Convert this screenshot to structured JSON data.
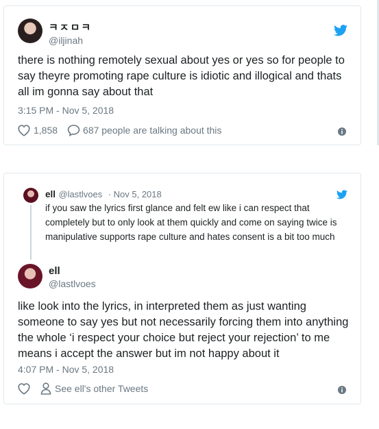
{
  "tweet1": {
    "name": "ㅋㅈㅁㅋ",
    "handle": "@iljinah",
    "text": "there is nothing remotely sexual about yes or yes so for people to say theyre promoting rape culture is idiotic and illogical and thats all im gonna say about that",
    "timestamp": "3:15 PM - Nov 5, 2018",
    "like_count": "1,858",
    "conversation": "687 people are talking about this"
  },
  "tweet2": {
    "quoted": {
      "name": "ell",
      "handle": "@lastlvoes",
      "date": "· Nov 5, 2018",
      "text": "if you saw the lyrics first glance and felt ew like i can respect that completely but to only look at them quickly and come on saying twice is manipulative supports rape culture and hates consent is a bit too much"
    },
    "name": "ell",
    "handle": "@lastlvoes",
    "text": "like look into the lyrics, in interpreted them as just wanting someone to say yes but not necessarily forcing them into anything the whole ‘i respect your choice but reject your rejection’ to me means i accept the answer but im not happy about it",
    "timestamp": "4:07 PM - Nov 5, 2018",
    "other_tweets": "See ell's other Tweets"
  },
  "colors": {
    "twitter_blue": "#1da1f2",
    "secondary": "#697882",
    "border": "#e1e8ed"
  },
  "icons": [
    "twitter-bird-icon",
    "heart-icon",
    "speech-bubble-icon",
    "info-icon",
    "person-icon"
  ]
}
